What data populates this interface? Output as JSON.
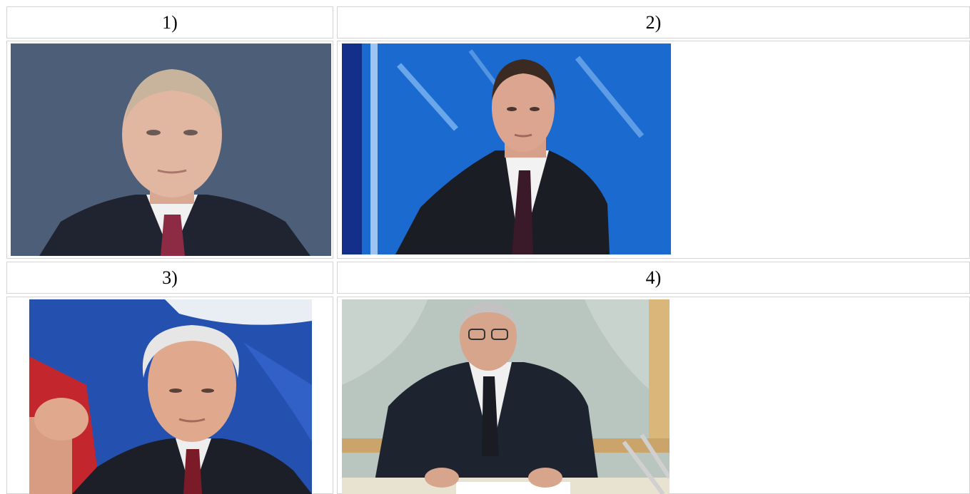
{
  "table": {
    "labels": [
      "1)",
      "2)",
      "3)",
      "4)"
    ]
  },
  "photos": [
    {
      "name": "portrait-1",
      "background": "#4d5e78"
    },
    {
      "name": "portrait-2",
      "background": "#1b6ad0"
    },
    {
      "name": "portrait-3",
      "background": "#2450b0"
    },
    {
      "name": "portrait-4",
      "background": "#b9c6bf"
    }
  ]
}
